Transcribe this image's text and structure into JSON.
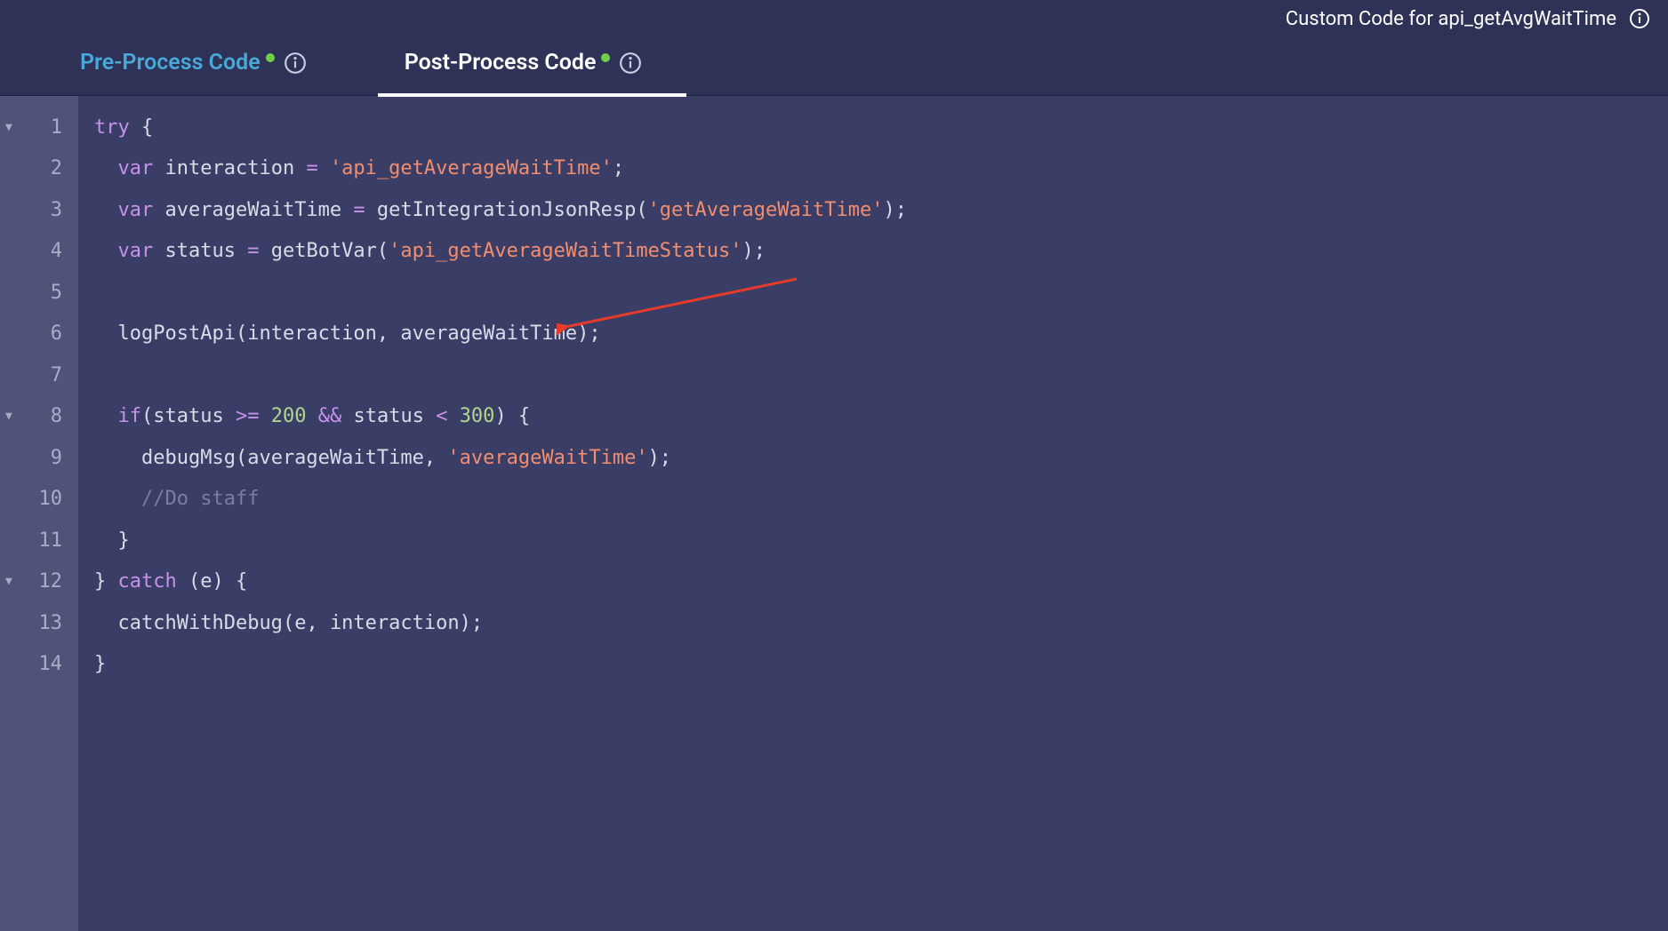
{
  "header": {
    "title": "Custom Code for api_getAvgWaitTime"
  },
  "tabs": {
    "pre": {
      "label": "Pre-Process Code"
    },
    "post": {
      "label": "Post-Process Code"
    }
  },
  "code": {
    "lines": [
      {
        "num": "1",
        "fold": true,
        "tokens": [
          [
            "kw",
            "try"
          ],
          [
            "punc",
            " {"
          ]
        ]
      },
      {
        "num": "2",
        "fold": false,
        "tokens": [
          [
            "punc",
            "  "
          ],
          [
            "var",
            "var"
          ],
          [
            "id",
            " interaction "
          ],
          [
            "op",
            "="
          ],
          [
            "punc",
            " "
          ],
          [
            "str",
            "'api_getAverageWaitTime'"
          ],
          [
            "punc",
            ";"
          ]
        ]
      },
      {
        "num": "3",
        "fold": false,
        "tokens": [
          [
            "punc",
            "  "
          ],
          [
            "var",
            "var"
          ],
          [
            "id",
            " averageWaitTime "
          ],
          [
            "op",
            "="
          ],
          [
            "id",
            " getIntegrationJsonResp"
          ],
          [
            "punc",
            "("
          ],
          [
            "str",
            "'getAverageWaitTime'"
          ],
          [
            "punc",
            ");"
          ]
        ]
      },
      {
        "num": "4",
        "fold": false,
        "tokens": [
          [
            "punc",
            "  "
          ],
          [
            "var",
            "var"
          ],
          [
            "id",
            " status "
          ],
          [
            "op",
            "="
          ],
          [
            "id",
            " getBotVar"
          ],
          [
            "punc",
            "("
          ],
          [
            "str",
            "'api_getAverageWaitTimeStatus'"
          ],
          [
            "punc",
            ");"
          ]
        ]
      },
      {
        "num": "5",
        "fold": false,
        "tokens": []
      },
      {
        "num": "6",
        "fold": false,
        "tokens": [
          [
            "punc",
            "  "
          ],
          [
            "id",
            "logPostApi"
          ],
          [
            "punc",
            "("
          ],
          [
            "id",
            "interaction"
          ],
          [
            "punc",
            ", "
          ],
          [
            "id",
            "averageWaitTime"
          ],
          [
            "punc",
            ");"
          ]
        ]
      },
      {
        "num": "7",
        "fold": false,
        "tokens": []
      },
      {
        "num": "8",
        "fold": true,
        "tokens": [
          [
            "punc",
            "  "
          ],
          [
            "kw",
            "if"
          ],
          [
            "punc",
            "("
          ],
          [
            "id",
            "status "
          ],
          [
            "op",
            ">="
          ],
          [
            "punc",
            " "
          ],
          [
            "num",
            "200"
          ],
          [
            "punc",
            " "
          ],
          [
            "op",
            "&&"
          ],
          [
            "id",
            " status "
          ],
          [
            "op",
            "<"
          ],
          [
            "punc",
            " "
          ],
          [
            "num",
            "300"
          ],
          [
            "punc",
            ") {"
          ]
        ]
      },
      {
        "num": "9",
        "fold": false,
        "tokens": [
          [
            "punc",
            "    "
          ],
          [
            "id",
            "debugMsg"
          ],
          [
            "punc",
            "("
          ],
          [
            "id",
            "averageWaitTime"
          ],
          [
            "punc",
            ", "
          ],
          [
            "str",
            "'averageWaitTime'"
          ],
          [
            "punc",
            ");"
          ]
        ]
      },
      {
        "num": "10",
        "fold": false,
        "tokens": [
          [
            "punc",
            "    "
          ],
          [
            "cmt",
            "//Do staff"
          ]
        ]
      },
      {
        "num": "11",
        "fold": false,
        "tokens": [
          [
            "punc",
            "  }"
          ]
        ]
      },
      {
        "num": "12",
        "fold": true,
        "tokens": [
          [
            "punc",
            "} "
          ],
          [
            "kw",
            "catch"
          ],
          [
            "punc",
            " ("
          ],
          [
            "id",
            "e"
          ],
          [
            "punc",
            ") {"
          ]
        ]
      },
      {
        "num": "13",
        "fold": false,
        "tokens": [
          [
            "punc",
            "  "
          ],
          [
            "id",
            "catchWithDebug"
          ],
          [
            "punc",
            "("
          ],
          [
            "id",
            "e"
          ],
          [
            "punc",
            ", "
          ],
          [
            "id",
            "interaction"
          ],
          [
            "punc",
            ");"
          ]
        ]
      },
      {
        "num": "14",
        "fold": false,
        "tokens": [
          [
            "punc",
            "}"
          ]
        ]
      }
    ]
  }
}
